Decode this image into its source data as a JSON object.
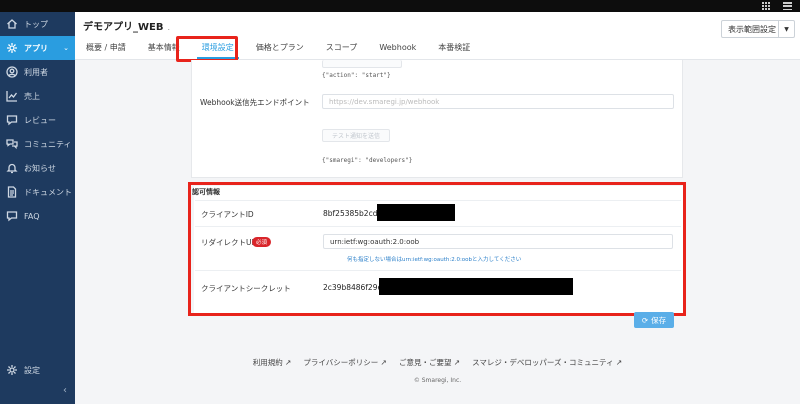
{
  "sidebar": {
    "items": [
      {
        "label": "トップ",
        "icon": "home-icon"
      },
      {
        "label": "アプリ",
        "icon": "gear-icon",
        "active": true
      },
      {
        "label": "利用者",
        "icon": "user-icon"
      },
      {
        "label": "売上",
        "icon": "chart-icon"
      },
      {
        "label": "レビュー",
        "icon": "review-icon"
      },
      {
        "label": "コミュニティ",
        "icon": "community-icon"
      },
      {
        "label": "お知らせ",
        "icon": "bell-icon"
      },
      {
        "label": "ドキュメント",
        "icon": "document-icon"
      },
      {
        "label": "FAQ",
        "icon": "faq-icon"
      }
    ],
    "settings_label": "設定",
    "collapse_glyph": "‹"
  },
  "header": {
    "app_title": "デモアプリ_WEB",
    "app_title_suffix": ".",
    "scope_select": "表示範囲設定",
    "tabs": [
      "概要 / 申請",
      "基本情報",
      "環境設定",
      "価格とプラン",
      "スコープ",
      "Webhook",
      "本番検証"
    ],
    "active_tab": 2
  },
  "env": {
    "action_code": "{\"action\": \"start\"}",
    "webhook_label": "Webhook送信先エンドポイント",
    "webhook_placeholder": "https://dev.smaregi.jp/webhook",
    "test_button": "テスト通知を送信",
    "code_json": "{\"smaregi\": \"developers\"}"
  },
  "auth": {
    "section_title": "認可情報",
    "client_id_label": "クライアントID",
    "client_id_value": "8bf25385b2cda5",
    "redirect_label": "リダイレクトURI",
    "required_badge": "必須",
    "redirect_value": "urn:ietf:wg:oauth:2.0:oob",
    "redirect_hint_link": "何も指定しない場合はurn:ietf:wg:oauth:2.0:oobと入力してください",
    "client_secret_label": "クライアントシークレット",
    "client_secret_value": "2c39b8486f29e1"
  },
  "save_button": "保存",
  "footer": {
    "links": [
      "利用規約 ↗",
      "プライバシーポリシー ↗",
      "ご意見・ご要望 ↗",
      "スマレジ・デベロッパーズ・コミュニティ ↗"
    ],
    "copyright": "© Smaregi, Inc."
  },
  "colors": {
    "sidebar": "#1e3a5f",
    "accent": "#2a9de0",
    "highlight": "#e8231b"
  }
}
